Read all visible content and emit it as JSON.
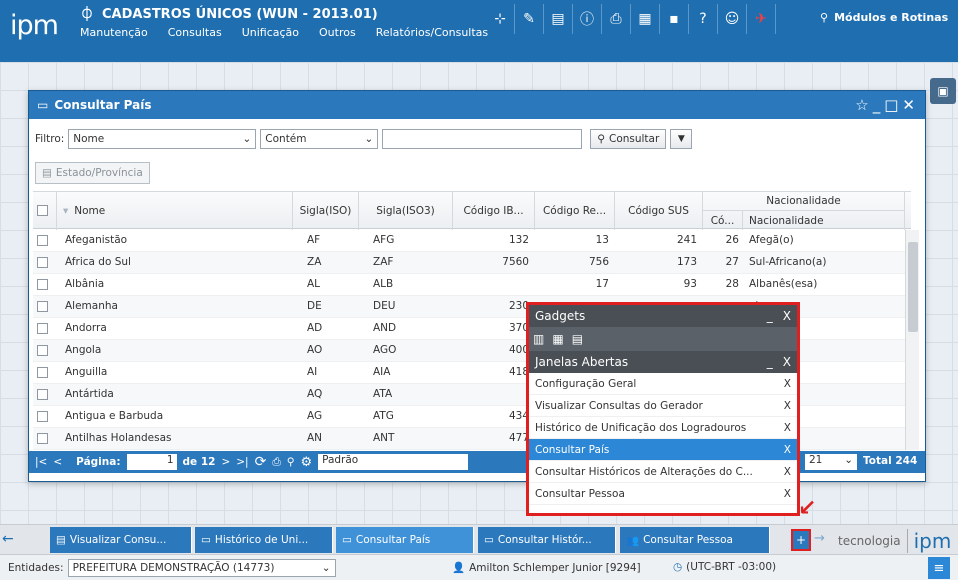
{
  "app": {
    "logo": "ipm",
    "title": "CADASTROS ÚNICOS (WUN - 2013.01)",
    "menu": [
      "Manutenção",
      "Consultas",
      "Unificação",
      "Outros",
      "Relatórios/Consultas"
    ],
    "modules_label": "Módulos e Rotinas"
  },
  "window": {
    "title": "Consultar País",
    "filter": {
      "label": "Filtro:",
      "field": "Nome",
      "operator": "Contém",
      "value": "",
      "consult_label": "Consultar"
    },
    "estado_button": "Estado/Província",
    "columns": {
      "nome": "Nome",
      "sigla_iso": "Sigla(ISO)",
      "sigla_iso3": "Sigla(ISO3)",
      "codigo_ibge": "Código IB...",
      "codigo_re": "Código Re...",
      "codigo_sus": "Código SUS",
      "nacionalidade_group": "Nacionalidade",
      "nac_codigo": "Có...",
      "nac_nome": "Nacionalidade"
    },
    "rows": [
      {
        "nome": "Afeganistão",
        "iso": "AF",
        "iso3": "AFG",
        "ibge": "132",
        "re": "13",
        "sus": "241",
        "nac_cod": "26",
        "nac": "Afegã(o)"
      },
      {
        "nome": "África do Sul",
        "iso": "ZA",
        "iso3": "ZAF",
        "ibge": "7560",
        "re": "756",
        "sus": "173",
        "nac_cod": "27",
        "nac": "Sul-Africano(a)"
      },
      {
        "nome": "Albânia",
        "iso": "AL",
        "iso3": "ALB",
        "ibge": "",
        "re": "17",
        "sus": "93",
        "nac_cod": "28",
        "nac": "Albanês(esa)"
      },
      {
        "nome": "Alemanha",
        "iso": "DE",
        "iso3": "DEU",
        "ibge": "230",
        "re": "",
        "sus": "",
        "nac_cod": "",
        "nac": "o)"
      },
      {
        "nome": "Andorra",
        "iso": "AD",
        "iso3": "AND",
        "ibge": "370",
        "re": "",
        "sus": "",
        "nac_cod": "",
        "nac": "no(a)"
      },
      {
        "nome": "Angola",
        "iso": "AO",
        "iso3": "AGO",
        "ibge": "400",
        "re": "",
        "sus": "",
        "nac_cod": "",
        "nac": "o(a)"
      },
      {
        "nome": "Anguilla",
        "iso": "AI",
        "iso3": "AIA",
        "ibge": "418",
        "re": "",
        "sus": "",
        "nac_cod": "",
        "nac": "o(a)"
      },
      {
        "nome": "Antártida",
        "iso": "AQ",
        "iso3": "ATA",
        "ibge": "",
        "re": "",
        "sus": "",
        "nac_cod": "",
        "nac": ""
      },
      {
        "nome": "Antigua e Barbuda",
        "iso": "AG",
        "iso3": "ATG",
        "ibge": "434",
        "re": "",
        "sus": "",
        "nac_cod": "",
        "nac": "o(a)"
      },
      {
        "nome": "Antilhas Holandesas",
        "iso": "AN",
        "iso3": "ANT",
        "ibge": "477",
        "re": "",
        "sus": "",
        "nac_cod": "",
        "nac": "o(a)"
      }
    ],
    "paging": {
      "page_label": "Página:",
      "page": "1",
      "of_label": "de 12",
      "layout": "Padrão",
      "page_size": "21",
      "total": "Total 244"
    }
  },
  "gadgets": {
    "title": "Gadgets",
    "open_windows_title": "Janelas Abertas",
    "minimize": "_",
    "close": "X",
    "items": [
      {
        "label": "Configuração Geral",
        "active": false
      },
      {
        "label": "Visualizar Consultas do Gerador",
        "active": false
      },
      {
        "label": "Histórico de Unificação dos Logradouros",
        "active": false
      },
      {
        "label": "Consultar País",
        "active": true
      },
      {
        "label": "Consultar Históricos de Alterações do C...",
        "active": false
      },
      {
        "label": "Consultar Pessoa",
        "active": false
      }
    ]
  },
  "taskbar": {
    "tasks": [
      {
        "label": "Visualizar Consu...",
        "icon": "report-icon"
      },
      {
        "label": "Histórico de Uni...",
        "icon": "window-icon"
      },
      {
        "label": "Consultar País",
        "icon": "window-icon"
      },
      {
        "label": "Consultar Histór...",
        "icon": "window-icon"
      },
      {
        "label": "Consultar Pessoa",
        "icon": "people-icon"
      }
    ],
    "plus": "+",
    "brand_text": "tecnologia",
    "brand_logo": "ipm"
  },
  "status": {
    "entities_label": "Entidades:",
    "entity": "PREFEITURA DEMONSTRAÇÃO (14773)",
    "user": "Amilton Schlemper Junior [9294]",
    "timezone": "(UTC-BRT -03:00)"
  },
  "colors": {
    "primary": "#1f6fb0",
    "accent": "#2c88d6",
    "highlight": "#e02020"
  }
}
